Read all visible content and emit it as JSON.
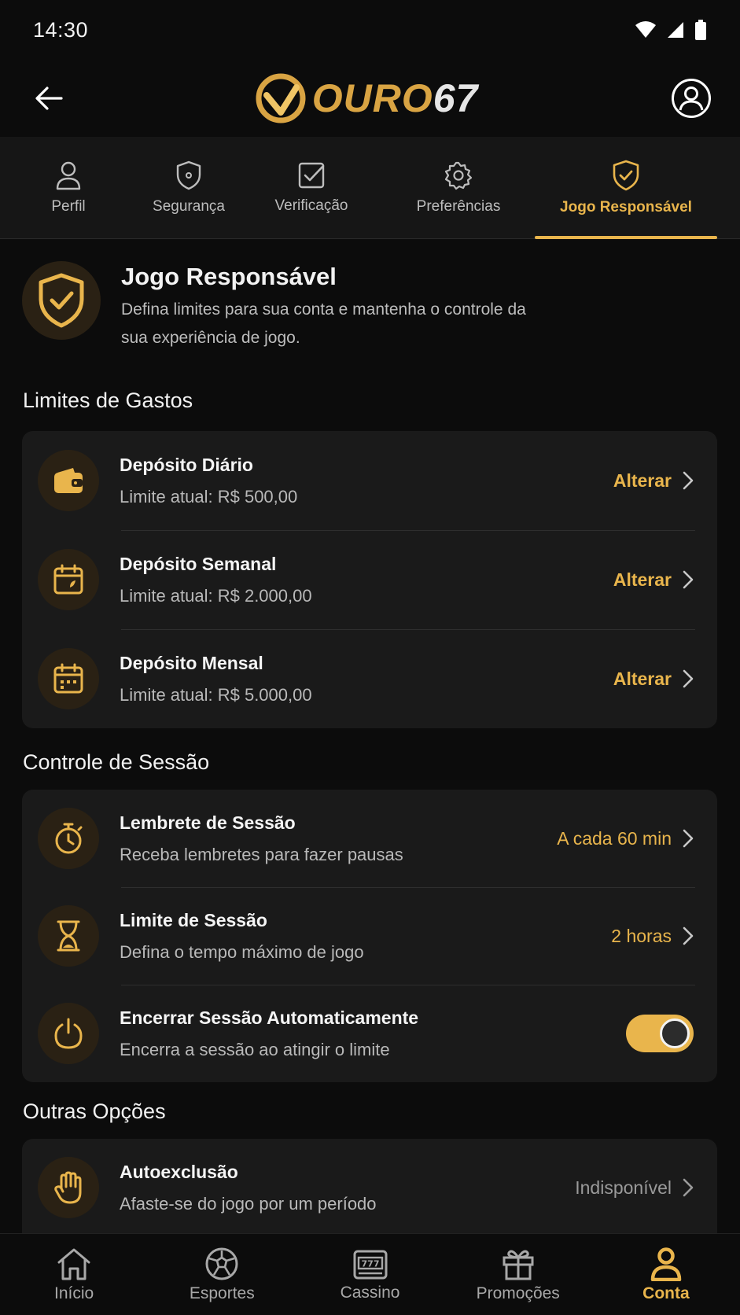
{
  "status_bar": {
    "time": "14:30"
  },
  "header": {
    "logo_text": "OURO",
    "logo_number": "67"
  },
  "tabs": [
    {
      "label": "Perfil",
      "icon": "person-icon"
    },
    {
      "label": "Segurança",
      "icon": "shield-lock-icon"
    },
    {
      "label": "Verificação",
      "icon": "checkbox-icon"
    },
    {
      "label": "Preferências",
      "icon": "gear-icon"
    },
    {
      "label": "Jogo Responsável",
      "icon": "shield-check-icon",
      "active": true
    }
  ],
  "intro": {
    "title": "Jogo Responsável",
    "description": "Defina limites para sua conta e mantenha o controle da sua experiência de jogo."
  },
  "spending": {
    "title": "Limites de Gastos",
    "items": [
      {
        "title": "Depósito Diário",
        "subtitle": "Limite atual: R$ 500,00",
        "action": "Alterar",
        "icon": "wallet-icon"
      },
      {
        "title": "Depósito Semanal",
        "subtitle": "Limite atual: R$ 2.000,00",
        "action": "Alterar",
        "icon": "calendar-icon"
      },
      {
        "title": "Depósito Mensal",
        "subtitle": "Limite atual: R$ 5.000,00",
        "action": "Alterar",
        "icon": "calendar-month-icon"
      }
    ]
  },
  "session": {
    "title": "Controle de Sessão",
    "items": [
      {
        "title": "Lembrete de Sessão",
        "subtitle": "Receba lembretes para fazer pausas",
        "action": "A cada 60 min",
        "icon": "stopwatch-icon"
      },
      {
        "title": "Limite de Sessão",
        "subtitle": "Defina o tempo máximo de jogo",
        "action": "2 horas",
        "icon": "hourglass-icon"
      },
      {
        "title": "Encerrar Sessão Automaticamente",
        "subtitle": "Encerra a sessão ao atingir o limite",
        "toggle_on": true,
        "icon": "power-icon"
      }
    ]
  },
  "other": {
    "title": "Outras Opções",
    "items": [
      {
        "title": "Autoexclusão",
        "subtitle": "Afaste-se do jogo por um período",
        "action": "Indisponível",
        "icon": "hand-icon"
      }
    ]
  },
  "bottom_nav": [
    {
      "label": "Início",
      "icon": "home-icon"
    },
    {
      "label": "Esportes",
      "icon": "ball-icon"
    },
    {
      "label": "Cassino",
      "icon": "slot-machine-icon"
    },
    {
      "label": "Promoções",
      "icon": "gift-icon"
    },
    {
      "label": "Conta",
      "icon": "user-icon",
      "active": true
    }
  ],
  "colors": {
    "accent": "#e9b54c",
    "background": "#0c0c0c",
    "card": "#1a1a1a"
  }
}
